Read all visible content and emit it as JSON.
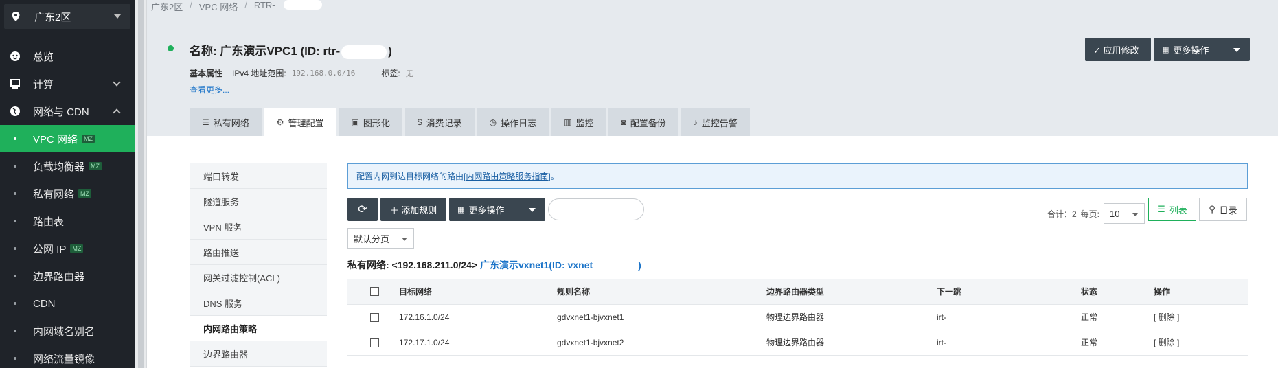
{
  "sidebar": {
    "region": "广东2区",
    "items": [
      {
        "label": "总览"
      },
      {
        "label": "计算"
      },
      {
        "label": "网络与 CDN"
      }
    ],
    "sub_items": [
      {
        "label": "VPC 网络",
        "tag": "MZ"
      },
      {
        "label": "负载均衡器",
        "tag": "MZ"
      },
      {
        "label": "私有网络",
        "tag": "MZ"
      },
      {
        "label": "路由表",
        "tag": ""
      },
      {
        "label": "公网 IP",
        "tag": "MZ"
      },
      {
        "label": "边界路由器",
        "tag": ""
      },
      {
        "label": "CDN",
        "tag": ""
      },
      {
        "label": "内网域名别名",
        "tag": ""
      },
      {
        "label": "网络流量镜像",
        "tag": ""
      }
    ]
  },
  "breadcrumb": [
    "广东2区",
    "VPC 网络",
    "RTR-"
  ],
  "header": {
    "title_prefix": "名称: 广东演示VPC1 (ID: rtr-",
    "title_suffix": ")",
    "basic_label": "基本属性",
    "ipv4_label": "IPv4 地址范围:",
    "ipv4_value": "192.168.0.0/16",
    "tag_label": "标签:",
    "tag_value": "无",
    "more_link": "查看更多...",
    "apply_button": "✓ 应用修改",
    "more_ops_button": "更多操作"
  },
  "tabs": [
    {
      "label": "私有网络",
      "icon": "☰"
    },
    {
      "label": "管理配置",
      "icon": "⚙"
    },
    {
      "label": "图形化",
      "icon": "▣"
    },
    {
      "label": "消费记录",
      "icon": "$"
    },
    {
      "label": "操作日志",
      "icon": "◷"
    },
    {
      "label": "监控",
      "icon": "▥"
    },
    {
      "label": "配置备份",
      "icon": "◙"
    },
    {
      "label": "监控告警",
      "icon": "♪"
    }
  ],
  "left_menu": [
    "端口转发",
    "隧道服务",
    "VPN 服务",
    "路由推送",
    "网关过滤控制(ACL)",
    "DNS 服务",
    "内网路由策略",
    "边界路由器"
  ],
  "notice": {
    "text": "配置内网到达目标网络的路由",
    "link": "[内网路由策略服务指南]",
    "end": "。"
  },
  "toolbar": {
    "refresh_icon": "⟳",
    "add_rule": "＋ 添加规则",
    "more_ops": "更多操作",
    "total": "合计：2",
    "per_page_label": "每页:",
    "per_page_value": "10",
    "list_view": "列表",
    "tree_view": "目录"
  },
  "paging_select": "默认分页",
  "network_line": {
    "prefix": "私有网络:  <192.168.211.0/24>",
    "link": "广东演示vxnet1(ID: vxnet",
    "suffix": ")"
  },
  "table": {
    "headers": [
      "目标网络",
      "规则名称",
      "边界路由器类型",
      "下一跳",
      "状态",
      "操作"
    ],
    "rows": [
      {
        "dest": "172.16.1.0/24",
        "name": "gdvxnet1-bjvxnet1",
        "type": "物理边界路由器",
        "next": "irt-",
        "status": "正常",
        "op": "[ 删除 ]"
      },
      {
        "dest": "172.17.1.0/24",
        "name": "gdvxnet1-bjvxnet2",
        "type": "物理边界路由器",
        "next": "irt-",
        "status": "正常",
        "op": "[ 删除 ]"
      }
    ]
  },
  "colors": {
    "sidebar_bg": "#1f2329",
    "active_green": "#1fb05b",
    "dark_button": "#3a4650",
    "link_blue": "#1a73c8"
  }
}
